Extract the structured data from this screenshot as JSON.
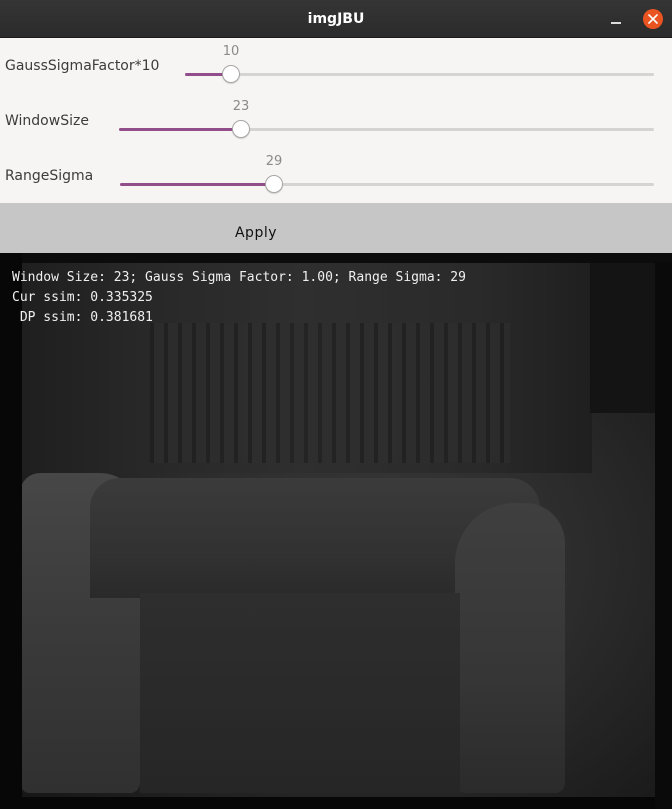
{
  "window": {
    "title": "imgJBU"
  },
  "icons": {
    "minimize": "minimize-icon",
    "close": "close-icon"
  },
  "colors": {
    "accent": "#924d8b",
    "close_button": "#e95420"
  },
  "sliders": [
    {
      "label": "GaussSigmaFactor*10",
      "value": "10"
    },
    {
      "label": "WindowSize",
      "value": "23"
    },
    {
      "label": "RangeSigma",
      "value": "29"
    }
  ],
  "apply": {
    "label": "Apply"
  },
  "overlay": {
    "line1": "Window Size: 23; Gauss Sigma Factor: 1.00; Range Sigma: 29",
    "line2": "Cur ssim: 0.335325",
    "line3": " DP ssim: 0.381681"
  }
}
